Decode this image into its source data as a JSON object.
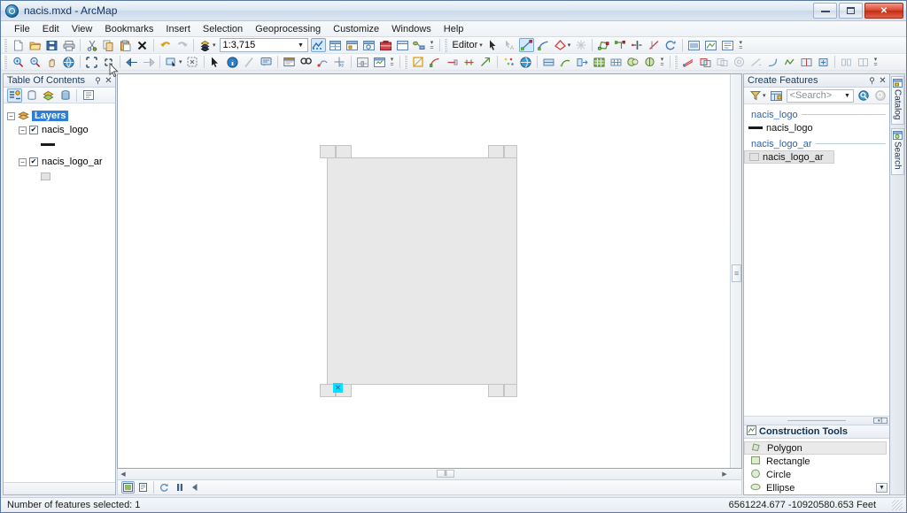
{
  "window": {
    "title": "nacis.mxd - ArcMap",
    "app_icon": "globe-icon",
    "minimize_label": "Minimize",
    "maximize_label": "Maximize",
    "close_label": "Close"
  },
  "menubar": {
    "items": [
      {
        "label": "File"
      },
      {
        "label": "Edit"
      },
      {
        "label": "View"
      },
      {
        "label": "Bookmarks"
      },
      {
        "label": "Insert"
      },
      {
        "label": "Selection"
      },
      {
        "label": "Geoprocessing"
      },
      {
        "label": "Customize"
      },
      {
        "label": "Windows"
      },
      {
        "label": "Help"
      }
    ]
  },
  "standard_toolbar": {
    "scale": "1:3,715",
    "buttons": [
      {
        "name": "new-map-icon",
        "title": "New Map File"
      },
      {
        "name": "open-icon",
        "title": "Open"
      },
      {
        "name": "save-icon",
        "title": "Save"
      },
      {
        "name": "print-icon",
        "title": "Print"
      },
      {
        "name": "cut-icon",
        "title": "Cut"
      },
      {
        "name": "copy-icon",
        "title": "Copy"
      },
      {
        "name": "paste-icon",
        "title": "Paste"
      },
      {
        "name": "delete-icon",
        "title": "Delete"
      },
      {
        "name": "undo-icon",
        "title": "Undo"
      },
      {
        "name": "redo-icon",
        "title": "Redo"
      },
      {
        "name": "add-data-icon",
        "title": "Add Data"
      }
    ],
    "after_scale_buttons": [
      {
        "name": "editor-toolbar-icon",
        "title": "Editor Toolbar"
      },
      {
        "name": "table-of-contents-icon",
        "title": "Table Of Contents"
      },
      {
        "name": "catalog-window-icon",
        "title": "Catalog Window"
      },
      {
        "name": "search-window-icon",
        "title": "Search Window"
      },
      {
        "name": "arctoolbox-icon",
        "title": "ArcToolbox"
      },
      {
        "name": "python-window-icon",
        "title": "Python Window"
      },
      {
        "name": "model-builder-icon",
        "title": "ModelBuilder"
      }
    ],
    "editor_label": "Editor"
  },
  "tools_toolbar": {
    "buttons": [
      {
        "name": "zoom-in-icon",
        "title": "Zoom In"
      },
      {
        "name": "zoom-out-icon",
        "title": "Zoom Out"
      },
      {
        "name": "pan-icon",
        "title": "Pan"
      },
      {
        "name": "full-extent-icon",
        "title": "Full Extent"
      },
      {
        "name": "fixed-zoom-in-icon",
        "title": "Fixed Zoom In"
      },
      {
        "name": "fixed-zoom-out-icon",
        "title": "Fixed Zoom Out"
      },
      {
        "name": "previous-extent-icon",
        "title": "Go Back To Previous Extent"
      },
      {
        "name": "next-extent-icon",
        "title": "Go To Next Extent"
      },
      {
        "name": "select-features-icon",
        "title": "Select Features"
      },
      {
        "name": "clear-selection-icon",
        "title": "Clear Selected Features"
      },
      {
        "name": "select-elements-icon",
        "title": "Select Elements"
      },
      {
        "name": "identify-icon",
        "title": "Identify"
      },
      {
        "name": "measure-icon",
        "title": "Measure"
      },
      {
        "name": "hyperlink-icon",
        "title": "Hyperlink"
      },
      {
        "name": "html-popup-icon",
        "title": "HTML Popup"
      },
      {
        "name": "find-icon",
        "title": "Find"
      },
      {
        "name": "find-route-icon",
        "title": "Find Route"
      },
      {
        "name": "go-to-xy-icon",
        "title": "Go To XY"
      },
      {
        "name": "time-slider-icon",
        "title": "Time Slider"
      },
      {
        "name": "create-viewer-icon",
        "title": "Create Viewer Window"
      }
    ]
  },
  "toc": {
    "caption": "Table Of Contents",
    "pin_icon": "pin-icon",
    "close_icon": "close-icon",
    "toolbar_buttons": [
      {
        "name": "list-by-drawing-order-icon",
        "title": "List By Drawing Order",
        "active": true
      },
      {
        "name": "list-by-source-icon",
        "title": "List By Source"
      },
      {
        "name": "list-by-visibility-icon",
        "title": "List By Visibility"
      },
      {
        "name": "list-by-selection-icon",
        "title": "List By Selection"
      },
      {
        "name": "options-icon",
        "title": "Options"
      }
    ],
    "root": "Layers",
    "layers": [
      {
        "name": "nacis_logo",
        "checked": true,
        "symbol": "line",
        "expanded": true
      },
      {
        "name": "nacis_logo_ar",
        "checked": true,
        "symbol": "polygon",
        "expanded": true
      }
    ]
  },
  "map": {
    "polygon_label": "nacis-logo-polygon",
    "selected_vertex_label": "selected-vertex"
  },
  "view_bar": {
    "buttons": [
      {
        "name": "data-view-icon",
        "title": "Data View",
        "active": true
      },
      {
        "name": "layout-view-icon",
        "title": "Layout View"
      },
      {
        "name": "refresh-icon",
        "title": "Refresh View"
      },
      {
        "name": "pause-drawing-icon",
        "title": "Pause Drawing"
      },
      {
        "name": "toggle-drawing-icon",
        "title": "Toggle Drawing"
      }
    ]
  },
  "create_features": {
    "caption": "Create Features",
    "pin_icon": "pin-icon",
    "close_icon": "close-icon",
    "search_placeholder": "<Search>",
    "toolbar_buttons": [
      {
        "name": "filter-templates-icon",
        "title": "Filter Templates"
      },
      {
        "name": "organize-templates-icon",
        "title": "Organize Templates"
      },
      {
        "name": "search-go-icon",
        "title": "Search"
      },
      {
        "name": "clear-search-icon",
        "title": "Clear Search"
      }
    ],
    "groups": [
      {
        "label": "nacis_logo",
        "templates": [
          {
            "label": "nacis_logo",
            "symbol": "line",
            "selected": false
          }
        ]
      },
      {
        "label": "nacis_logo_ar",
        "templates": [
          {
            "label": "nacis_logo_ar",
            "symbol": "polygon",
            "selected": true
          }
        ]
      }
    ]
  },
  "construction_tools": {
    "caption": "Construction Tools",
    "caption_icon": "construction-tools-icon",
    "items": [
      {
        "label": "Polygon",
        "icon": "polygon-tool-icon",
        "selected": true
      },
      {
        "label": "Rectangle",
        "icon": "rectangle-tool-icon",
        "selected": false
      },
      {
        "label": "Circle",
        "icon": "circle-tool-icon",
        "selected": false
      },
      {
        "label": "Ellipse",
        "icon": "ellipse-tool-icon",
        "selected": false
      }
    ],
    "scroll_down_icon": "chevron-down-icon"
  },
  "dock_tabs": [
    {
      "label": "Catalog",
      "icon": "catalog-icon"
    },
    {
      "label": "Search",
      "icon": "search-icon"
    }
  ],
  "statusbar": {
    "message": "Number of features selected: 1",
    "coordinates": "6561224.677  -10920580.653 Feet"
  },
  "colors": {
    "accent": "#2f7fd6",
    "selection_cyan": "#00e5ff",
    "template_link": "#2a63a8",
    "polygon_fill": "#e8e8e8",
    "polygon_stroke": "#c4c4c4"
  }
}
